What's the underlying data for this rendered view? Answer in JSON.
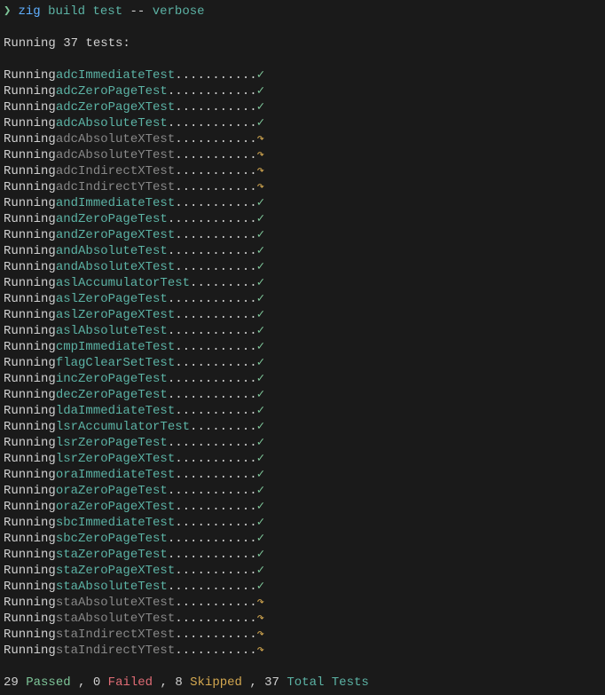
{
  "prompt": {
    "chevron": "❯",
    "cmd_zig": "zig",
    "cmd_build": "build",
    "cmd_test": "test",
    "cmd_dash": "--",
    "cmd_verbose": "verbose"
  },
  "header": "Running 37 tests:",
  "running_label": "Running ",
  "tests": [
    {
      "name": "adcImmediateTest",
      "status": "passed"
    },
    {
      "name": "adcZeroPageTest",
      "status": "passed"
    },
    {
      "name": "adcZeroPageXTest",
      "status": "passed"
    },
    {
      "name": "adcAbsoluteTest",
      "status": "passed"
    },
    {
      "name": "adcAbsoluteXTest",
      "status": "skipped"
    },
    {
      "name": "adcAbsoluteYTest",
      "status": "skipped"
    },
    {
      "name": "adcIndirectXTest",
      "status": "skipped"
    },
    {
      "name": "adcIndirectYTest",
      "status": "skipped"
    },
    {
      "name": "andImmediateTest",
      "status": "passed"
    },
    {
      "name": "andZeroPageTest",
      "status": "passed"
    },
    {
      "name": "andZeroPageXTest",
      "status": "passed"
    },
    {
      "name": "andAbsoluteTest",
      "status": "passed"
    },
    {
      "name": "andAbsoluteXTest",
      "status": "passed"
    },
    {
      "name": "aslAccumulatorTest",
      "status": "passed"
    },
    {
      "name": "aslZeroPageTest",
      "status": "passed"
    },
    {
      "name": "aslZeroPageXTest",
      "status": "passed"
    },
    {
      "name": "aslAbsoluteTest",
      "status": "passed"
    },
    {
      "name": "cmpImmediateTest",
      "status": "passed"
    },
    {
      "name": "flagClearSetTest",
      "status": "passed"
    },
    {
      "name": "incZeroPageTest",
      "status": "passed"
    },
    {
      "name": "decZeroPageTest",
      "status": "passed"
    },
    {
      "name": "ldaImmediateTest",
      "status": "passed"
    },
    {
      "name": "lsrAccumulatorTest",
      "status": "passed"
    },
    {
      "name": "lsrZeroPageTest",
      "status": "passed"
    },
    {
      "name": "lsrZeroPageXTest",
      "status": "passed"
    },
    {
      "name": "oraImmediateTest",
      "status": "passed"
    },
    {
      "name": "oraZeroPageTest",
      "status": "passed"
    },
    {
      "name": "oraZeroPageXTest",
      "status": "passed"
    },
    {
      "name": "sbcImmediateTest",
      "status": "passed"
    },
    {
      "name": "sbcZeroPageTest",
      "status": "passed"
    },
    {
      "name": "staZeroPageTest",
      "status": "passed"
    },
    {
      "name": "staZeroPageXTest",
      "status": "passed"
    },
    {
      "name": "staAbsoluteTest",
      "status": "passed"
    },
    {
      "name": "staAbsoluteXTest",
      "status": "skipped"
    },
    {
      "name": "staAbsoluteYTest",
      "status": "skipped"
    },
    {
      "name": "staIndirectXTest",
      "status": "skipped"
    },
    {
      "name": "staIndirectYTest",
      "status": "skipped"
    }
  ],
  "icons": {
    "check": "✓",
    "skip": "↷"
  },
  "dot_width": 27,
  "summary": {
    "passed_num": "29",
    "passed_label": "Passed",
    "failed_num": "0",
    "failed_label": "Failed",
    "skipped_num": "8",
    "skipped_label": "Skipped",
    "total_num": "37",
    "total_label": "Total Tests",
    "sep": ", "
  }
}
